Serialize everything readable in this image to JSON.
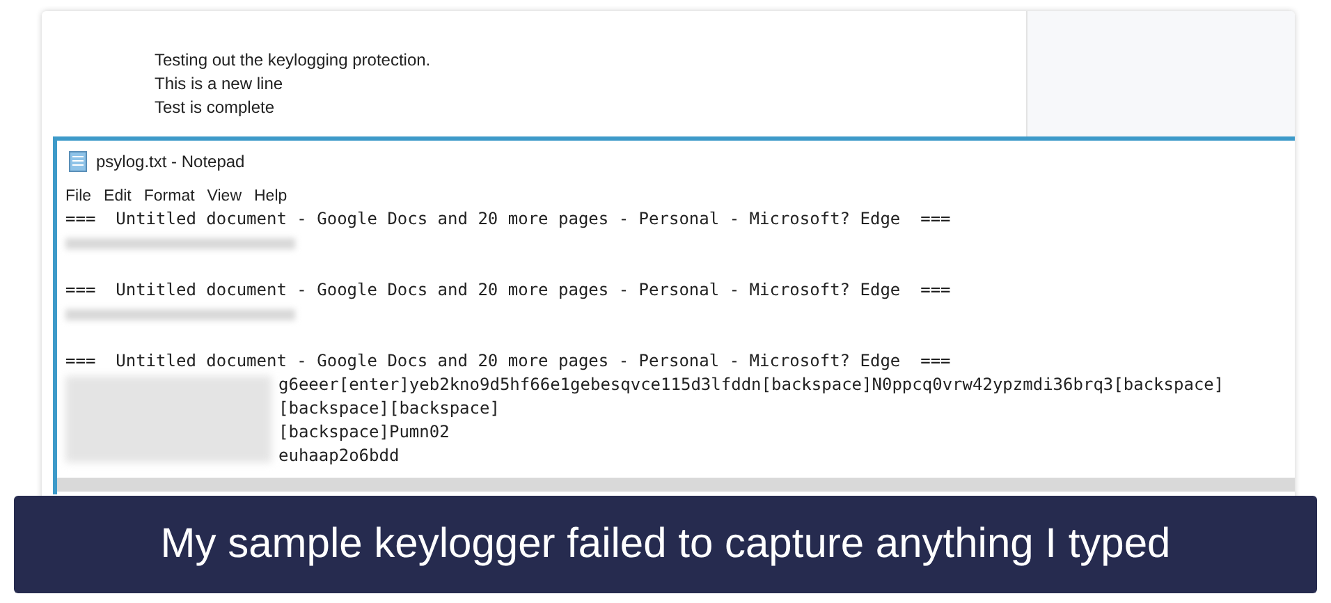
{
  "document": {
    "lines": [
      "Testing out the keylogging protection.",
      "This is a new line",
      "Test is complete"
    ]
  },
  "notepad": {
    "title": "psylog.txt - Notepad",
    "menu": [
      "File",
      "Edit",
      "Format",
      "View",
      "Help"
    ],
    "entries": [
      {
        "kind": "header",
        "text": "===  Untitled document - Google Docs and 20 more pages - Personal - Microsoft? Edge  ==="
      },
      {
        "kind": "redacted"
      },
      {
        "kind": "blank"
      },
      {
        "kind": "header",
        "text": "===  Untitled document - Google Docs and 20 more pages - Personal - Microsoft? Edge  ==="
      },
      {
        "kind": "redacted"
      },
      {
        "kind": "blank"
      },
      {
        "kind": "header",
        "text": "===  Untitled document - Google Docs and 20 more pages - Personal - Microsoft? Edge  ==="
      },
      {
        "kind": "keystrokes",
        "lines": [
          "g6eeer[enter]yeb2kno9d5hf66e1gebesqvce115d3lfddn[backspace]N0ppcq0vrw42ypzmdi36brq3[backspace]",
          "[backspace][backspace]",
          "[backspace]Pumn02",
          "euhaap2o6bdd"
        ]
      }
    ]
  },
  "caption": "My sample keylogger failed to capture anything I typed"
}
